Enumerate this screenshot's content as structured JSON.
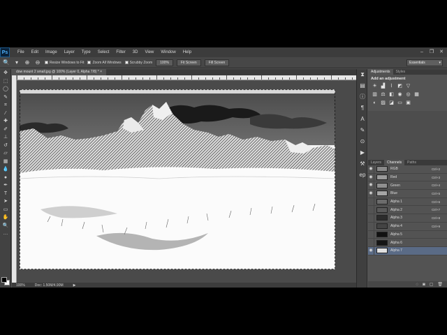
{
  "menubar": {
    "logo": "Ps",
    "items": [
      "File",
      "Edit",
      "Image",
      "Layer",
      "Type",
      "Select",
      "Filter",
      "3D",
      "View",
      "Window",
      "Help"
    ],
    "window_controls": [
      "minimize-icon",
      "restore-icon",
      "close-icon"
    ]
  },
  "options_bar": {
    "resize_windows": "Resize Windows to Fit",
    "zoom_all": "Zoom All Windows",
    "scrubby_zoom": "Scrubby Zoom",
    "btn_100": "100%",
    "btn_fit": "Fit Screen",
    "btn_fill": "Fill Screen",
    "workspace": "Essentials"
  },
  "document": {
    "tab_title": "dow mount 2 small.jpg @ 100% (Layer 0, Alpha 7/8) *",
    "zoom": "100%",
    "doc_size": "Doc: 1.50M/4.90M"
  },
  "adjustments": {
    "tabs": [
      "Adjustments",
      "Styles"
    ],
    "title": "Add an adjustment"
  },
  "channels": {
    "tabs": [
      "Layers",
      "Channels",
      "Paths"
    ],
    "rows": [
      {
        "name": "RGB",
        "shortcut": "Ctrl+2",
        "thumb": "#8a8a8a"
      },
      {
        "name": "Red",
        "shortcut": "Ctrl+3",
        "thumb": "#9a9a9a"
      },
      {
        "name": "Green",
        "shortcut": "Ctrl+4",
        "thumb": "#8f8f8f"
      },
      {
        "name": "Blue",
        "shortcut": "Ctrl+5",
        "thumb": "#a5a5a5"
      },
      {
        "name": "Alpha 1",
        "shortcut": "Ctrl+6",
        "thumb": "#6c6c6c"
      },
      {
        "name": "Alpha 2",
        "shortcut": "Ctrl+7",
        "thumb": "#5a5a5a"
      },
      {
        "name": "Alpha 3",
        "shortcut": "Ctrl+8",
        "thumb": "#2c2c2c"
      },
      {
        "name": "Alpha 4",
        "shortcut": "Ctrl+9",
        "thumb": "#444444"
      },
      {
        "name": "Alpha 5",
        "shortcut": "",
        "thumb": "#111111"
      },
      {
        "name": "Alpha 6",
        "shortcut": "",
        "thumb": "#151515"
      },
      {
        "name": "Alpha 7",
        "shortcut": "",
        "thumb": "#e0e0e0"
      }
    ]
  },
  "colors": {
    "app_bg": "#535353",
    "selection": "#5a6b86"
  }
}
